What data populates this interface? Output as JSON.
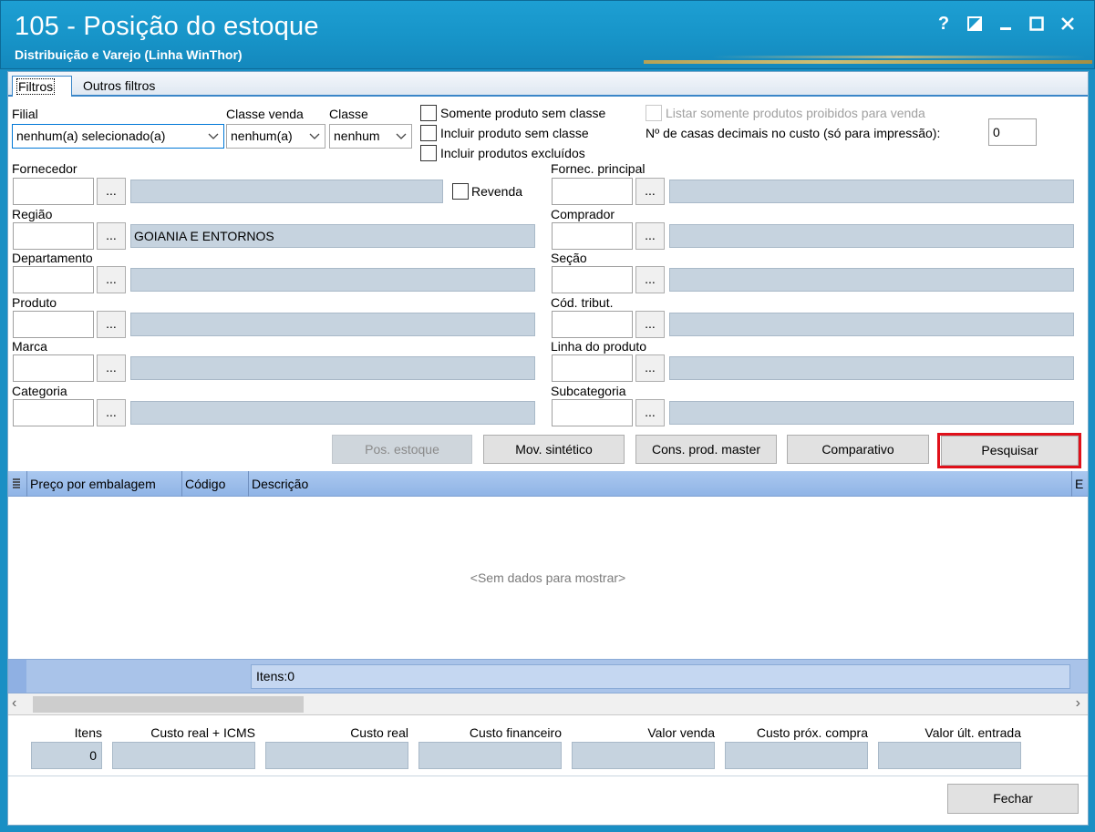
{
  "window": {
    "title": "105 - Posição do estoque",
    "subtitle": "Distribuição e Varejo (Linha WinThor)",
    "buttons": [
      "?",
      "◪",
      "_",
      "☐",
      "✕"
    ]
  },
  "tabs": [
    {
      "label": "Filtros",
      "active": true
    },
    {
      "label": "Outros filtros",
      "active": false
    }
  ],
  "filters": {
    "filial_label": "Filial",
    "filial_value": "nenhum(a) selecionado(a)",
    "classe_venda_label": "Classe venda",
    "classe_venda_value": "nenhum(a)",
    "classe_label": "Classe",
    "classe_value": "nenhum",
    "somente_sem_classe": "Somente produto sem classe",
    "incluir_sem_classe": "Incluir produto sem classe",
    "incluir_excluidos": "Incluir produtos excluídos",
    "listar_proibidos": "Listar somente produtos proibidos para venda",
    "casas_decimais_label": "Nº de casas decimais no custo (só para impressão):",
    "casas_decimais_value": "0",
    "fornecedor_label": "Fornecedor",
    "revenda_label": "Revenda",
    "fornec_principal_label": "Fornec. principal",
    "regiao_label": "Região",
    "regiao_desc": "GOIANIA E ENTORNOS",
    "comprador_label": "Comprador",
    "departamento_label": "Departamento",
    "secao_label": "Seção",
    "produto_label": "Produto",
    "cod_tribut_label": "Cód. tribut.",
    "marca_label": "Marca",
    "linha_produto_label": "Linha do produto",
    "categoria_label": "Categoria",
    "subcategoria_label": "Subcategoria",
    "ellipsis": "..."
  },
  "actions": {
    "pos_estoque": "Pos. estoque",
    "mov_sintetico": "Mov. sintético",
    "cons_prod_master": "Cons. prod. master",
    "comparativo": "Comparativo",
    "pesquisar": "Pesquisar"
  },
  "grid": {
    "columns": [
      "Preço por embalagem",
      "Código",
      "Descrição",
      "E"
    ],
    "empty_text": "<Sem dados para mostrar>",
    "footer_text": "Itens:0"
  },
  "totals": {
    "labels": [
      "Itens",
      "Custo real + ICMS",
      "Custo real",
      "Custo financeiro",
      "Valor venda",
      "Custo próx. compra",
      "Valor últ. entrada"
    ],
    "itens_value": "0"
  },
  "footer": {
    "fechar": "Fechar"
  }
}
